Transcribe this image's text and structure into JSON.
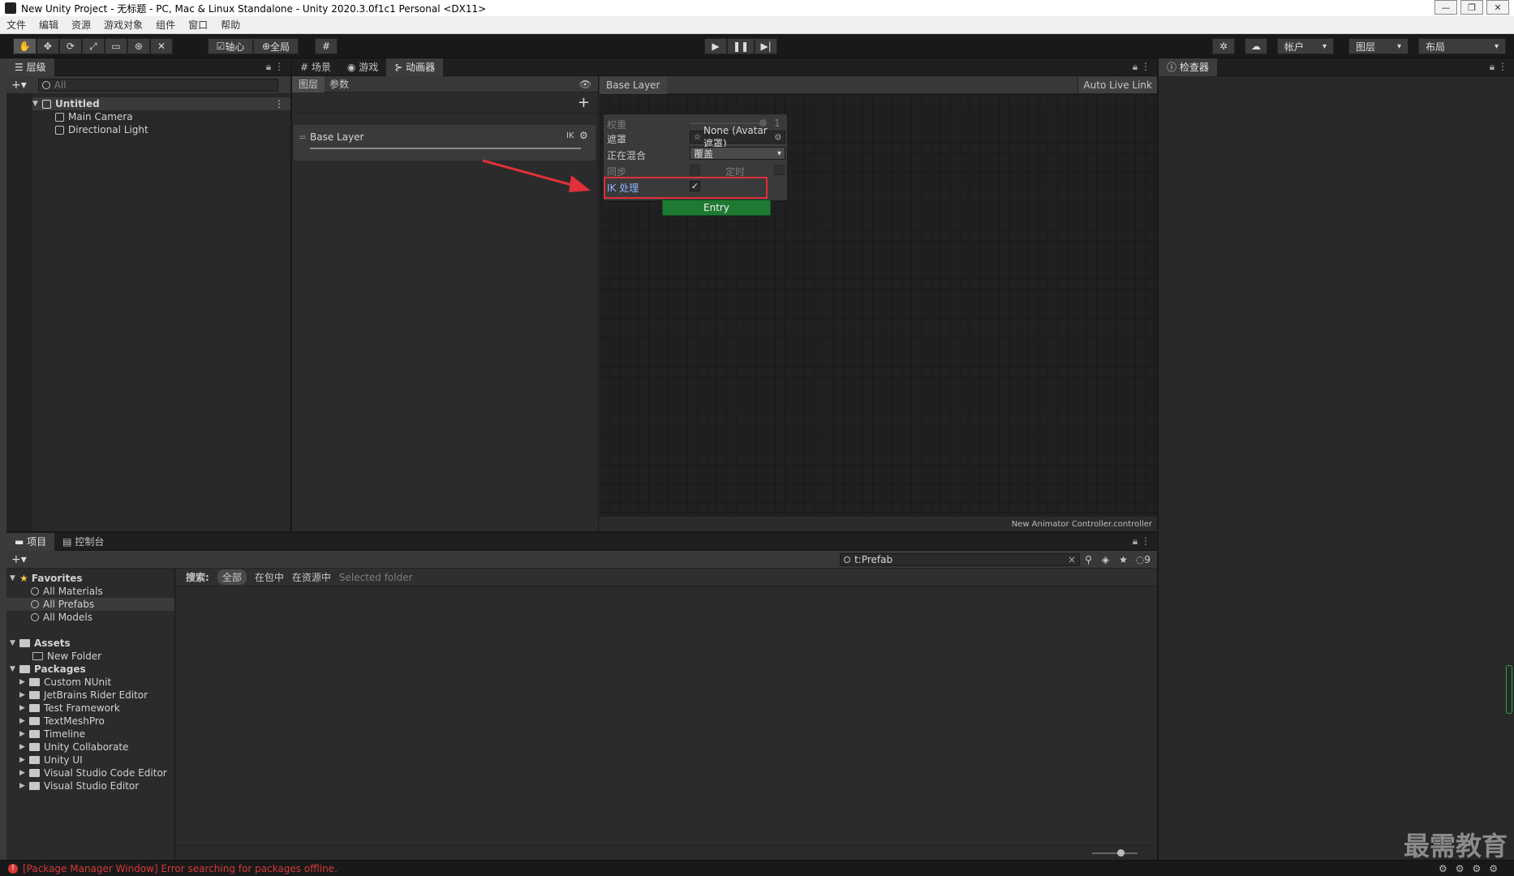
{
  "window": {
    "title": "New Unity Project - 无标题 - PC, Mac & Linux Standalone - Unity 2020.3.0f1c1 Personal <DX11>",
    "buttons": [
      "—",
      "❐",
      "✕"
    ]
  },
  "menu": [
    "文件",
    "编辑",
    "资源",
    "游戏对象",
    "组件",
    "窗口",
    "帮助"
  ],
  "toolbar": {
    "pivot_label": "轴心",
    "global_label": "全局",
    "account_label": "帐户",
    "layers_label": "图层",
    "layout_label": "布局"
  },
  "hierarchy": {
    "tab_label": "层级",
    "search_placeholder": "All",
    "scene_name": "Untitled",
    "items": [
      "Main Camera",
      "Directional Light"
    ]
  },
  "center_tabs": [
    "场景",
    "游戏",
    "动画器"
  ],
  "animator": {
    "subtabs": [
      "图层",
      "参数"
    ],
    "breadcrumb": "Base Layer",
    "auto_live_link": "Auto Live Link",
    "layer_name": "Base Layer",
    "ik_badge": "IK",
    "footer_file": "New Animator Controller.controller",
    "entry_label": "Entry",
    "settings": {
      "weight_label": "权重",
      "weight_value": "1",
      "mask_label": "遮罩",
      "mask_value": "None (Avatar 遮罩)",
      "blending_label": "正在混合",
      "blending_value": "覆盖",
      "sync_label": "同步",
      "timing_label": "定时",
      "ik_label": "IK 处理",
      "ik_checked": "✓"
    }
  },
  "inspector": {
    "tab_label": "检查器"
  },
  "bottom_tabs": [
    "项目",
    "控制台"
  ],
  "project": {
    "search_value": "t:Prefab",
    "hidden_count": "9",
    "search_scope_label": "搜索:",
    "scopes": [
      "全部",
      "在包中",
      "在资源中",
      "Selected folder"
    ],
    "favorites_label": "Favorites",
    "favorites": [
      "All Materials",
      "All Prefabs",
      "All Models"
    ],
    "assets_label": "Assets",
    "assets": [
      "New Folder"
    ],
    "packages_label": "Packages",
    "packages": [
      "Custom NUnit",
      "JetBrains Rider Editor",
      "Test Framework",
      "TextMeshPro",
      "Timeline",
      "Unity Collaborate",
      "Unity UI",
      "Visual Studio Code Editor",
      "Visual Studio Editor"
    ]
  },
  "status": {
    "error_text": "[Package Manager Window] Error searching for packages offline."
  },
  "watermark": "最需教育",
  "colors": {
    "highlight_red": "#e0303a",
    "entry_green": "#1e7a33",
    "error_red": "#d53838"
  }
}
